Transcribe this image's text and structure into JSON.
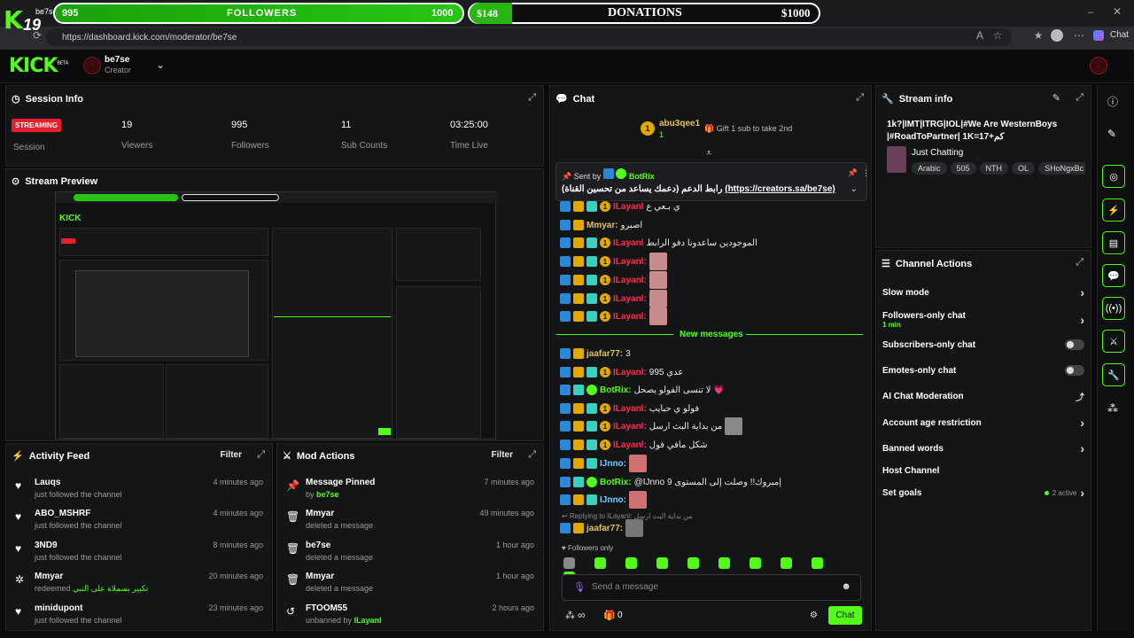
{
  "browser": {
    "url": "https://dashboard.kick.com/moderator/be7se",
    "tab_title": "be7se",
    "chat_label": "Chat"
  },
  "overlay": {
    "logo_text": "19",
    "followers_current": "995",
    "followers_label": "FOLLOWERS",
    "followers_goal": "1000",
    "followers_progress": 0.995,
    "donations_amount": "$148",
    "donations_label": "DONATIONS",
    "donations_goal": "$1000",
    "donations_progress": 0.148
  },
  "header": {
    "logo": "KICK",
    "logo_badge": "BETA",
    "channel_name": "be7se",
    "channel_role": "Creator"
  },
  "session": {
    "title": "Session Info",
    "status": "STREAMING",
    "status_label": "Session",
    "stats": [
      {
        "value": "19",
        "label": "Viewers"
      },
      {
        "value": "995",
        "label": "Followers"
      },
      {
        "value": "11",
        "label": "Sub Counts"
      },
      {
        "value": "03:25:00",
        "label": "Time Live"
      }
    ]
  },
  "preview": {
    "title": "Stream Preview"
  },
  "activity": {
    "title": "Activity Feed",
    "filter": "Filter",
    "items": [
      {
        "icon": "heart-icon",
        "name": "Lauqs",
        "sub": "just followed the channel",
        "time": "4 minutes ago"
      },
      {
        "icon": "heart-icon",
        "name": "ABO_MSHRF",
        "sub": "just followed the channel",
        "time": "4 minutes ago"
      },
      {
        "icon": "heart-icon",
        "name": "3ND9",
        "sub": "just followed the channel",
        "time": "8 minutes ago"
      },
      {
        "icon": "redeem-icon",
        "name": "Mmyar",
        "sub": "redeemed",
        "extra": "تكبير بسملاة على النبي",
        "time": "20 minutes ago"
      },
      {
        "icon": "heart-icon",
        "name": "minidupont",
        "sub": "just followed the channel",
        "time": "23 minutes ago"
      }
    ]
  },
  "mod": {
    "title": "Mod Actions",
    "filter": "Filter",
    "items": [
      {
        "icon": "pin-icon",
        "name": "Message Pinned",
        "sub": "by",
        "by": "be7se",
        "time": "7 minutes ago"
      },
      {
        "icon": "trash-icon",
        "name": "Mmyar",
        "sub": "deleted a message",
        "time": "49 minutes ago"
      },
      {
        "icon": "trash-icon",
        "name": "be7se",
        "sub": "deleted a message",
        "time": "1 hour ago"
      },
      {
        "icon": "trash-icon",
        "name": "Mmyar",
        "sub": "deleted a message",
        "time": "1 hour ago"
      },
      {
        "icon": "unban-icon",
        "name": "FTOOM55",
        "sub": "unbanned by",
        "by": "ILayanl",
        "time": "2 hours ago"
      }
    ]
  },
  "chat": {
    "title": "Chat",
    "top_gifter": "abu3qee1",
    "top_gifter_count": "1",
    "gift_prompt": "Gift 1 sub to take 2nd",
    "pinned": {
      "label": "Sent by",
      "user": "BotRix",
      "text": "رابط الدعم (دعمك يساعد من تحسين القناة)",
      "link": "(https://creators.sa/be7se)"
    },
    "lines_before": [
      {
        "user": "ILayanl",
        "text": "ي بـعي ع",
        "color": "#ff2b4b"
      },
      {
        "user": "Mmyar:",
        "text": "اصبرو",
        "color": "#e0c060"
      },
      {
        "user": "ILayanl",
        "text": "الموجودين ساعدونا دفو الرابط",
        "color": "#ff2b4b"
      },
      {
        "user": "ILayanl:",
        "text": "",
        "color": "#ff2b4b",
        "emote": true
      },
      {
        "user": "ILayanl:",
        "text": "",
        "color": "#ff2b4b",
        "emote": true
      },
      {
        "user": "ILayanl:",
        "text": "",
        "color": "#ff2b4b",
        "emote": true
      },
      {
        "user": "ILayanl:",
        "text": "",
        "color": "#ff2b4b",
        "emote": true
      }
    ],
    "new_messages": "New messages",
    "lines_after": [
      {
        "user": "jaafar77:",
        "text": "3",
        "color": "#e0c060"
      },
      {
        "user": "ILayanl:",
        "text": "995 عدي",
        "color": "#ff2b4b"
      },
      {
        "user": "BotRix:",
        "text": "لا تنسى الفولو يصحل 💗",
        "color": "#53fc18"
      },
      {
        "user": "ILayanl:",
        "text": "فولو ي حبايب",
        "color": "#ff2b4b"
      },
      {
        "user": "ILayanl:",
        "text": "من بداية البث ارسل",
        "color": "#ff2b4b"
      },
      {
        "user": "ILayanl:",
        "text": "شكل مافي فول",
        "color": "#ff2b4b"
      },
      {
        "user": "IJnno:",
        "text": "",
        "color": "#7ec8ff",
        "emote": true
      },
      {
        "user": "BotRix:",
        "text": "@IJnno 9 إمبروك!! وصلت إلى المستوى",
        "color": "#53fc18"
      },
      {
        "user": "IJnno:",
        "text": "",
        "color": "#7ec8ff",
        "emote": true
      }
    ],
    "reply_to": "Replying to ILayanl: من بداية البث ارسل",
    "reply_user": "jaafar77:",
    "followers_only": "Followers only",
    "input_placeholder": "Send a message",
    "infinity": "∞",
    "gift_count": "0",
    "send_label": "Chat"
  },
  "stream_info": {
    "title": "Stream info",
    "stream_title": "1k?|IMT|ITRG|IOL|#We Are WesternBoys |#RoadToPartner| 1K=17+كم",
    "category": "Just Chatting",
    "tags": [
      "Arabic",
      "505",
      "NTH",
      "OL",
      "SHoNgxBc"
    ]
  },
  "channel_actions": {
    "title": "Channel Actions",
    "items": [
      {
        "label": "Slow mode",
        "type": "chevron"
      },
      {
        "label": "Followers-only chat",
        "sub": "1 min",
        "type": "chevron"
      },
      {
        "label": "Subscribers-only chat",
        "type": "toggle"
      },
      {
        "label": "Emotes-only chat",
        "type": "toggle"
      },
      {
        "label": "AI Chat Moderation",
        "type": "external"
      },
      {
        "label": "Account age restriction",
        "type": "chevron"
      },
      {
        "label": "Banned words",
        "type": "chevron"
      },
      {
        "label": "Host Channel",
        "type": "none"
      },
      {
        "label": "Set goals",
        "status": "2 active",
        "type": "chevron"
      }
    ]
  },
  "colors": {
    "accent": "#53fc18",
    "live": "#e5202e",
    "panel": "#141517"
  }
}
